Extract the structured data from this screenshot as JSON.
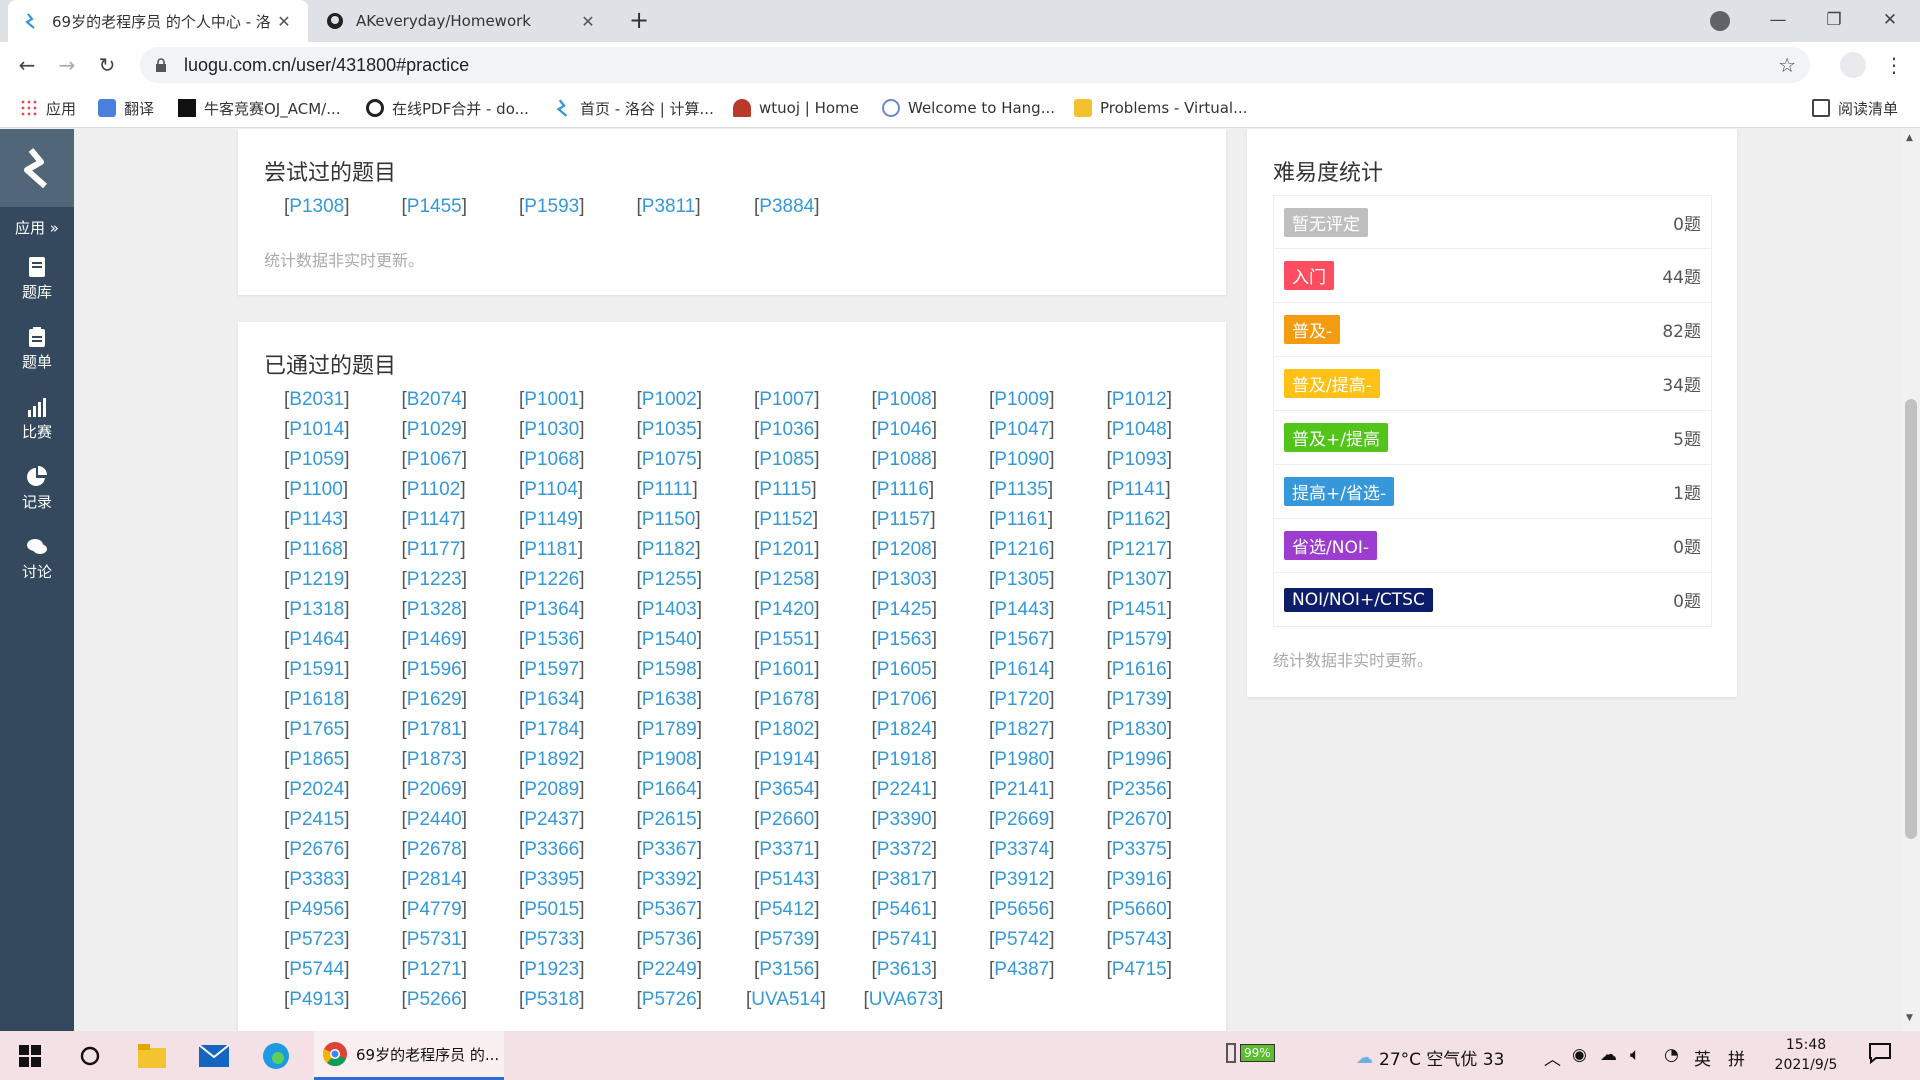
{
  "browser": {
    "tabs": [
      {
        "title": "69岁的老程序员 的个人中心 - 洛",
        "active": true
      },
      {
        "title": "AKeveryday/Homework",
        "active": false
      }
    ],
    "url": "luogu.com.cn/user/431800#practice",
    "bookmarks": [
      "应用",
      "翻译",
      "牛客竞赛OJ_ACM/...",
      "在线PDF合并 - do...",
      "首页 - 洛谷 | 计算...",
      "wtuoj | Home",
      "Welcome to Hang...",
      "Problems - Virtual..."
    ],
    "reading_list": "阅读清单"
  },
  "sidebar": {
    "items": [
      "应用",
      "题库",
      "题单",
      "比赛",
      "记录",
      "讨论"
    ]
  },
  "attempted": {
    "title": "尝试过的题目",
    "problems": [
      "P1308",
      "P1455",
      "P1593",
      "P3811",
      "P3884"
    ],
    "note": "统计数据非实时更新。"
  },
  "passed": {
    "title": "已通过的题目",
    "problems": [
      "B2031",
      "B2074",
      "P1001",
      "P1002",
      "P1007",
      "P1008",
      "P1009",
      "P1012",
      "P1014",
      "P1029",
      "P1030",
      "P1035",
      "P1036",
      "P1046",
      "P1047",
      "P1048",
      "P1059",
      "P1067",
      "P1068",
      "P1075",
      "P1085",
      "P1088",
      "P1090",
      "P1093",
      "P1100",
      "P1102",
      "P1104",
      "P1111",
      "P1115",
      "P1116",
      "P1135",
      "P1141",
      "P1143",
      "P1147",
      "P1149",
      "P1150",
      "P1152",
      "P1157",
      "P1161",
      "P1162",
      "P1168",
      "P1177",
      "P1181",
      "P1182",
      "P1201",
      "P1208",
      "P1216",
      "P1217",
      "P1219",
      "P1223",
      "P1226",
      "P1255",
      "P1258",
      "P1303",
      "P1305",
      "P1307",
      "P1318",
      "P1328",
      "P1364",
      "P1403",
      "P1420",
      "P1425",
      "P1443",
      "P1451",
      "P1464",
      "P1469",
      "P1536",
      "P1540",
      "P1551",
      "P1563",
      "P1567",
      "P1579",
      "P1591",
      "P1596",
      "P1597",
      "P1598",
      "P1601",
      "P1605",
      "P1614",
      "P1616",
      "P1618",
      "P1629",
      "P1634",
      "P1638",
      "P1678",
      "P1706",
      "P1720",
      "P1739",
      "P1765",
      "P1781",
      "P1784",
      "P1789",
      "P1802",
      "P1824",
      "P1827",
      "P1830",
      "P1865",
      "P1873",
      "P1892",
      "P1908",
      "P1914",
      "P1918",
      "P1980",
      "P1996",
      "P2024",
      "P2069",
      "P2089",
      "P1664",
      "P3654",
      "P2241",
      "P2141",
      "P2356",
      "P2415",
      "P2440",
      "P2437",
      "P2615",
      "P2660",
      "P3390",
      "P2669",
      "P2670",
      "P2676",
      "P2678",
      "P3366",
      "P3367",
      "P3371",
      "P3372",
      "P3374",
      "P3375",
      "P3383",
      "P2814",
      "P3395",
      "P3392",
      "P5143",
      "P3817",
      "P3912",
      "P3916",
      "P4956",
      "P4779",
      "P5015",
      "P5367",
      "P5412",
      "P5461",
      "P5656",
      "P5660",
      "P5723",
      "P5731",
      "P5733",
      "P5736",
      "P5739",
      "P5741",
      "P5742",
      "P5743",
      "P5744",
      "P1271",
      "P1923",
      "P2249",
      "P3156",
      "P3613",
      "P4387",
      "P4715",
      "P4913",
      "P5266",
      "P5318",
      "P5726",
      "UVA514",
      "UVA673"
    ]
  },
  "difficulty": {
    "title": "难易度统计",
    "levels": [
      {
        "label": "暂无评定",
        "count": "0题",
        "color": "#bfbfbf"
      },
      {
        "label": "入门",
        "count": "44题",
        "color": "#fe4c61"
      },
      {
        "label": "普及-",
        "count": "82题",
        "color": "#f39c11"
      },
      {
        "label": "普及/提高-",
        "count": "34题",
        "color": "#ffc116"
      },
      {
        "label": "普及+/提高",
        "count": "5题",
        "color": "#52c41a"
      },
      {
        "label": "提高+/省选-",
        "count": "1题",
        "color": "#3498db"
      },
      {
        "label": "省选/NOI-",
        "count": "0题",
        "color": "#9d3dcf"
      },
      {
        "label": "NOI/NOI+/CTSC",
        "count": "0题",
        "color": "#0e1d69"
      }
    ],
    "note": "统计数据非实时更新。"
  },
  "taskbar": {
    "chrome_task": "69岁的老程序员 的...",
    "battery": "99%",
    "weather": "27°C 空气优 33",
    "ime1": "英",
    "ime2": "拼",
    "time": "15:48",
    "date": "2021/9/5"
  }
}
